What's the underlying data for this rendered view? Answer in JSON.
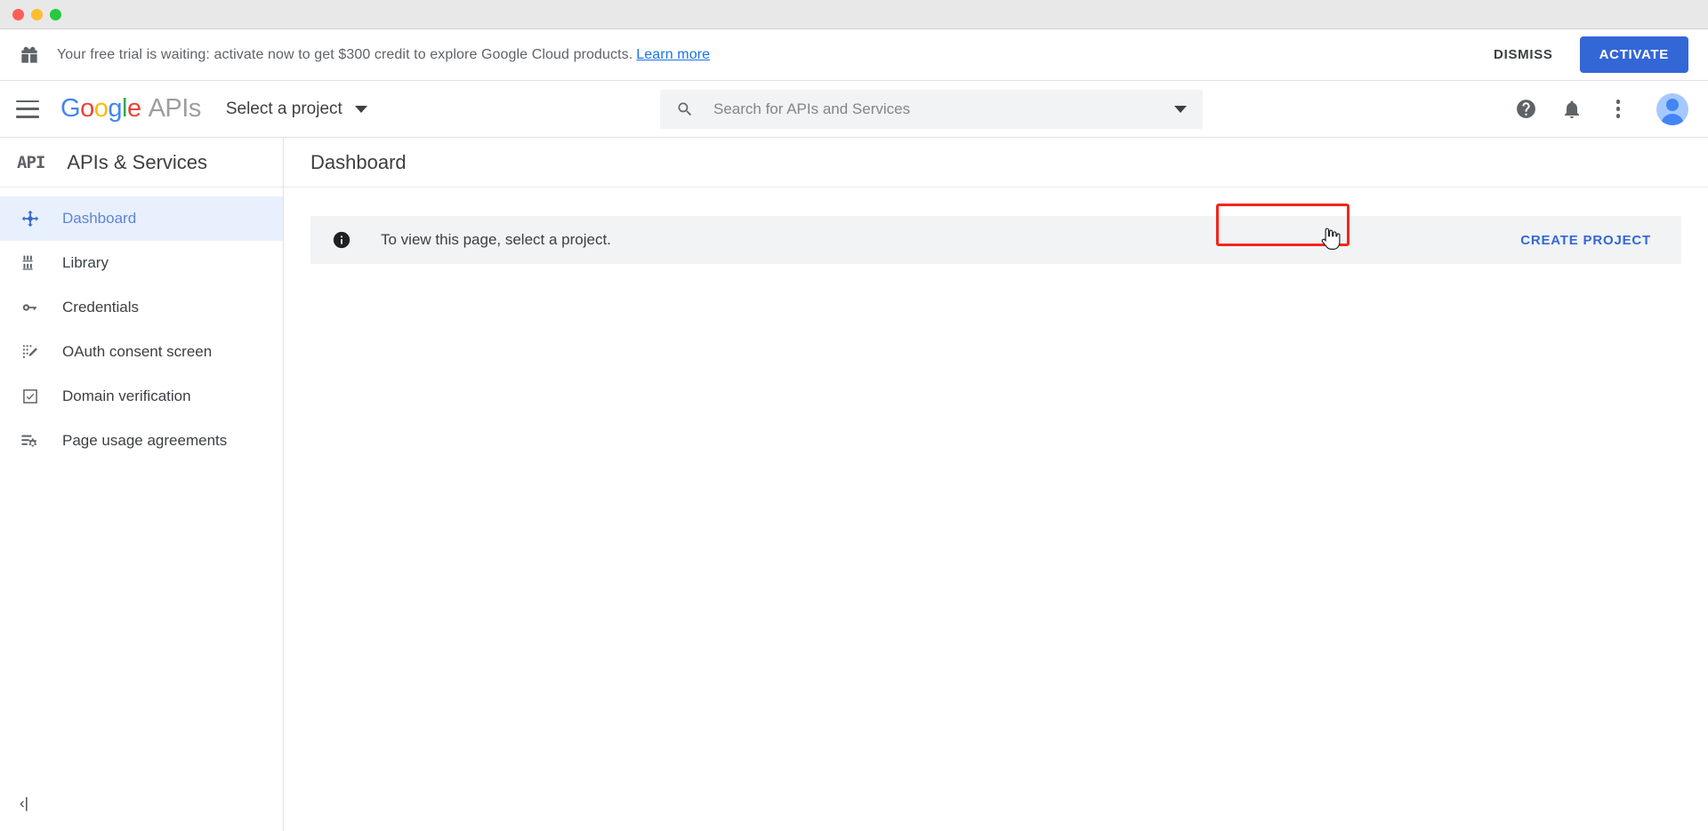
{
  "window": {
    "traffic_lights": [
      "close",
      "minimize",
      "zoom"
    ],
    "colors": {
      "close": "#ff5f57",
      "minimize": "#febc2e",
      "zoom": "#28c840"
    }
  },
  "banner": {
    "icon": "gift-icon",
    "message": "Your free trial is waiting: activate now to get $300 credit to explore Google Cloud products.",
    "link_label": "Learn more",
    "dismiss_label": "DISMISS",
    "activate_label": "ACTIVATE",
    "activate_color": "#3367d6"
  },
  "topbar": {
    "menu_icon": "hamburger-menu-icon",
    "brand": {
      "g1": "G",
      "o1": "o",
      "o2": "o",
      "g2": "g",
      "l1": "l",
      "e1": "e",
      "suffix": "APIs"
    },
    "project_selector_label": "Select a project",
    "search": {
      "icon": "search-icon",
      "placeholder": "Search for APIs and Services",
      "value": ""
    },
    "help_icon": "help-circle-icon",
    "notifications_icon": "bell-icon",
    "more_icon": "kebab-menu-icon",
    "account_icon": "user-avatar-icon"
  },
  "sidebar": {
    "product_glyph": "API",
    "product_title": "APIs & Services",
    "items": [
      {
        "label": "Dashboard",
        "icon": "dashboard-icon",
        "active": true
      },
      {
        "label": "Library",
        "icon": "library-icon",
        "active": false
      },
      {
        "label": "Credentials",
        "icon": "key-icon",
        "active": false
      },
      {
        "label": "OAuth consent screen",
        "icon": "oauth-consent-icon",
        "active": false
      },
      {
        "label": "Domain verification",
        "icon": "checkbox-verified-icon",
        "active": false
      },
      {
        "label": "Page usage agreements",
        "icon": "page-settings-icon",
        "active": false
      }
    ],
    "collapse_label": "‹|",
    "active_color": "#e8f0fe",
    "active_text_color": "#5e84d8"
  },
  "main": {
    "page_title": "Dashboard",
    "info_card": {
      "icon": "info-icon",
      "message": "To view this page, select a project.",
      "action_label": "CREATE PROJECT",
      "action_color": "#3367d6",
      "background": "#f1f3f4"
    }
  },
  "annotation": {
    "highlight_color": "#f4251c",
    "highlight_target": "CREATE PROJECT",
    "cursor": "pointer-hand-cursor"
  }
}
